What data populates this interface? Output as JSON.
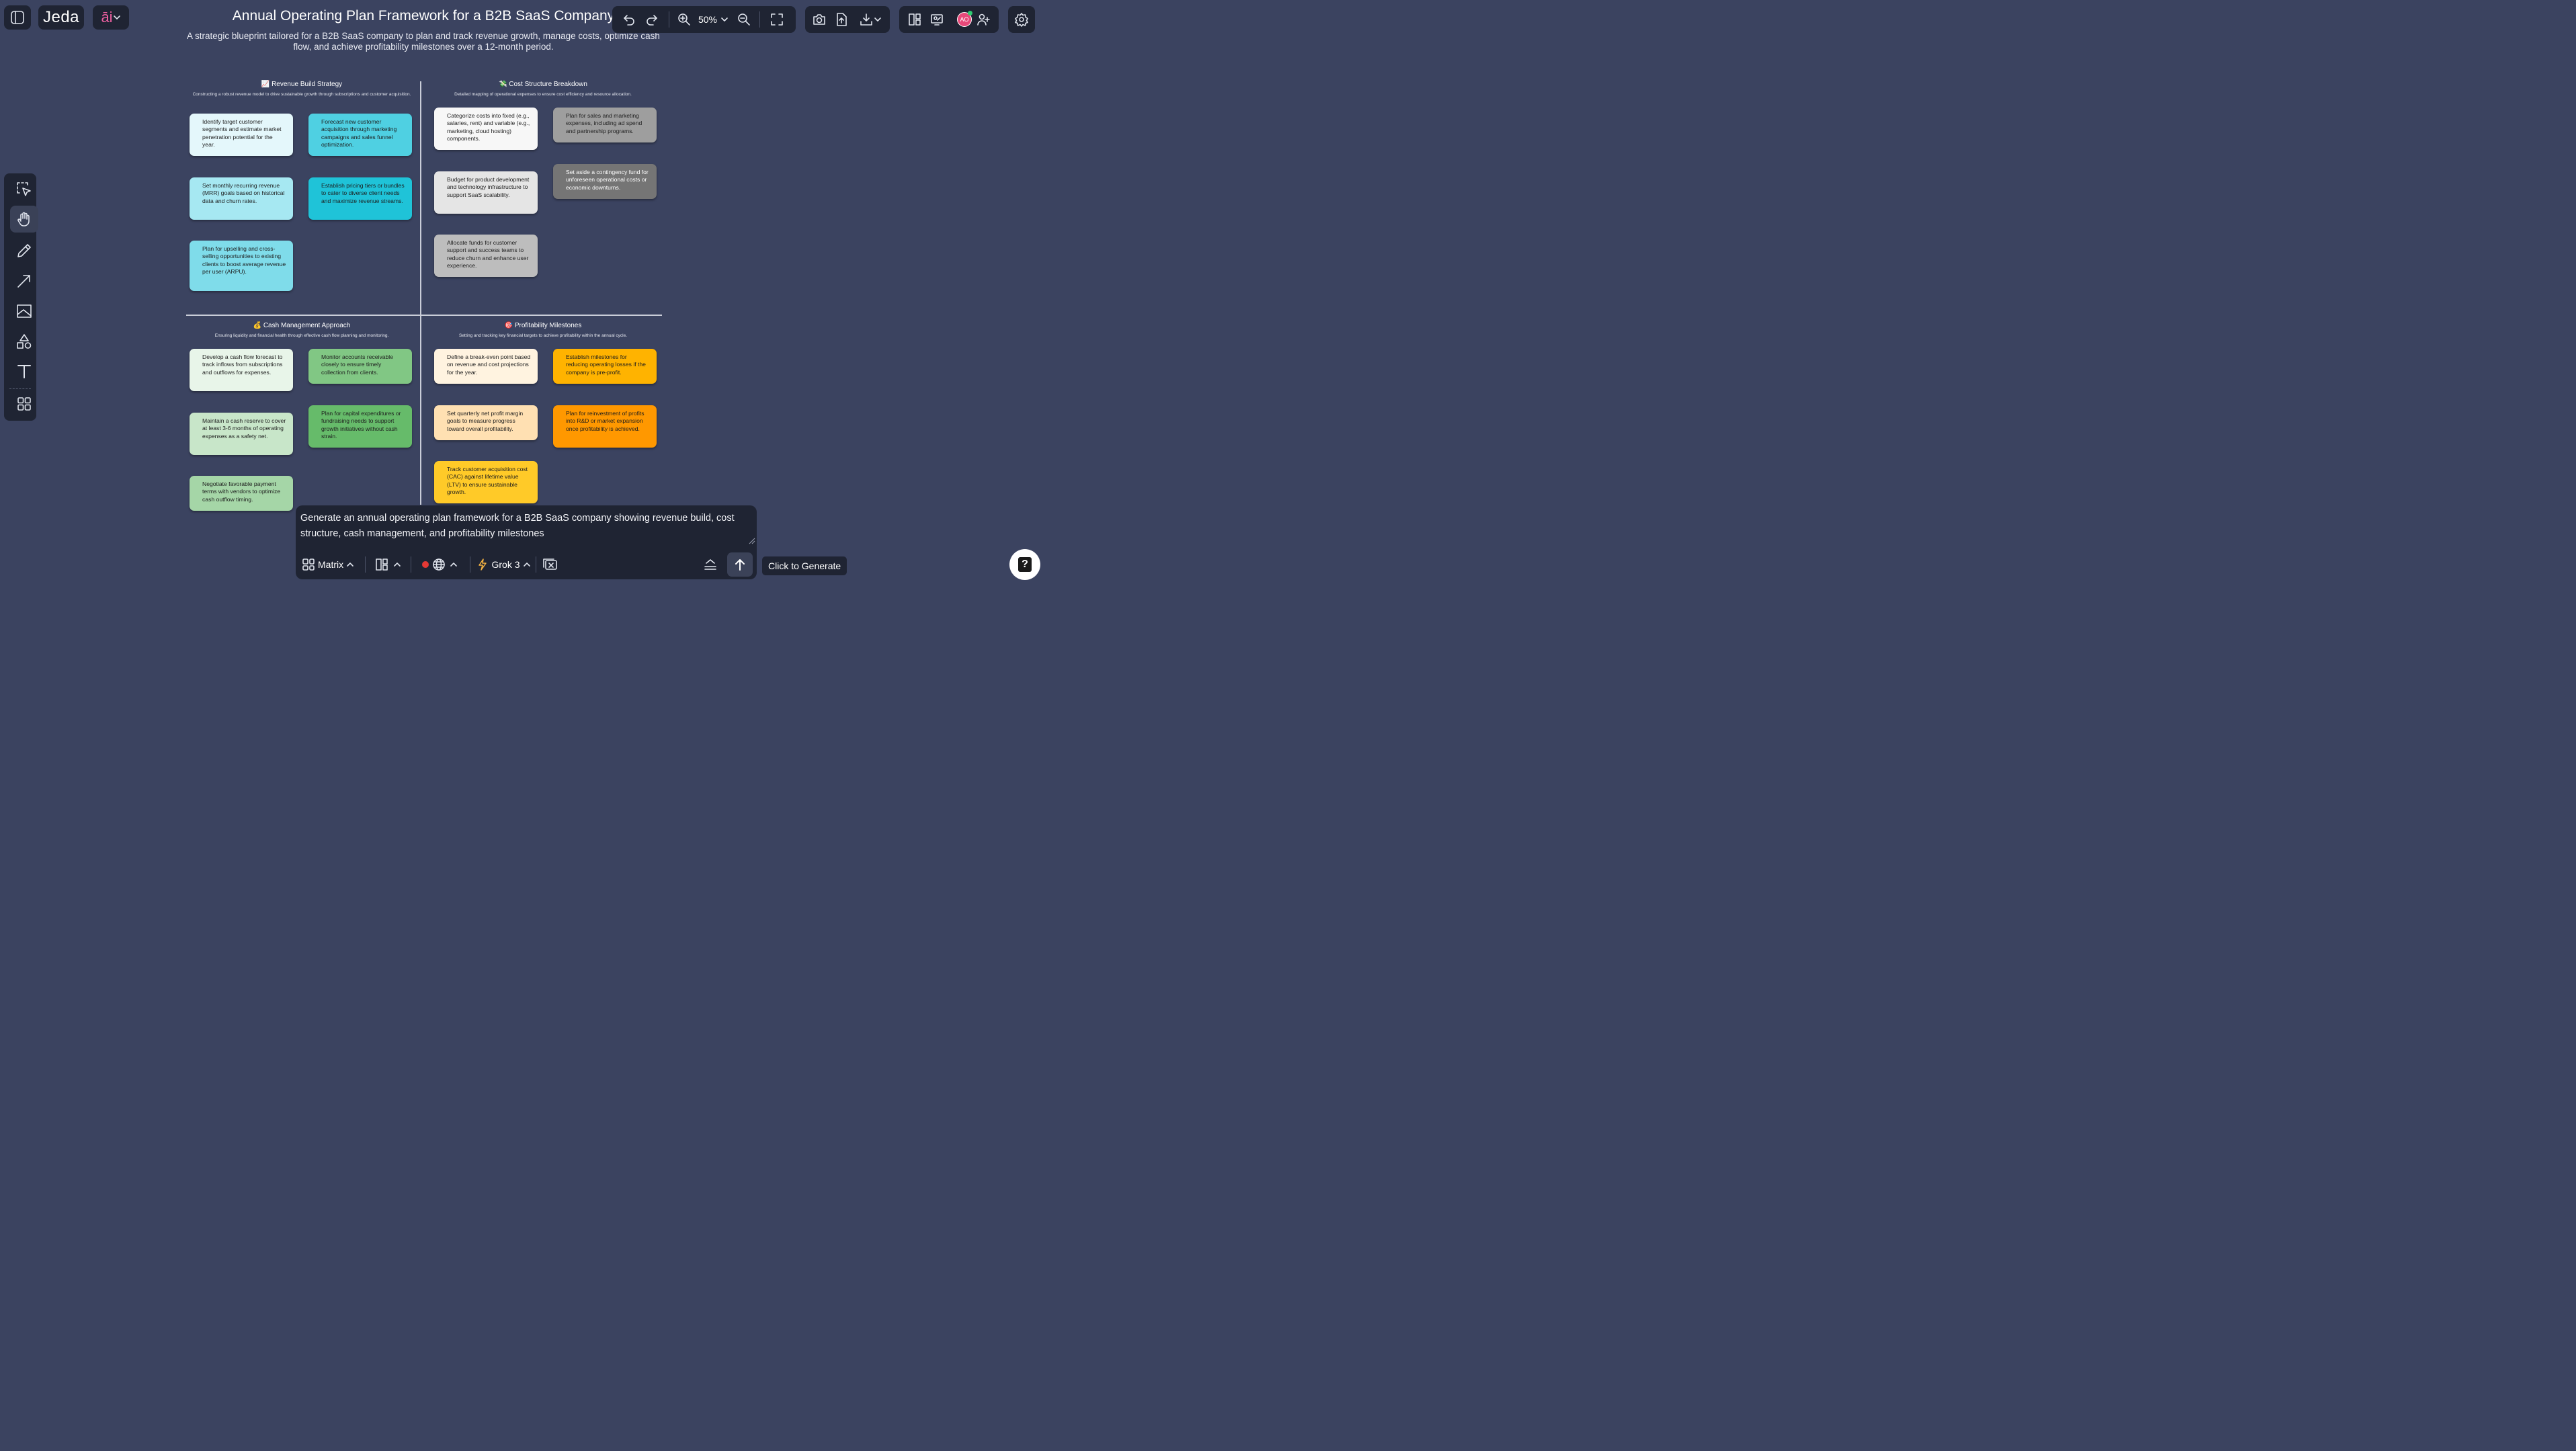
{
  "app": {
    "brand": "Jeda",
    "ai_label": "āi"
  },
  "toolbar": {
    "zoom": "50%"
  },
  "avatar": {
    "initials": "AO"
  },
  "header": {
    "title": "Annual Operating Plan Framework for a B2B SaaS Company",
    "subtitle": "A strategic blueprint tailored for a B2B SaaS company to plan and track revenue growth, manage costs, optimize cash flow, and achieve profitability milestones over a 12-month period."
  },
  "quadrants": [
    {
      "title": "📈 Revenue Build Strategy",
      "subtitle": "Constructing a robust revenue model to drive sustainable growth through subscriptions and customer acquisition.",
      "cards": [
        {
          "text": "Identify target customer segments and estimate market penetration potential for the year.",
          "color": "#e4f7fb"
        },
        {
          "text": "Forecast new customer acquisition through marketing campaigns and sales funnel optimization.",
          "color": "#4fd0e2"
        },
        {
          "text": "Set monthly recurring revenue (MRR) goals based on historical data and churn rates.",
          "color": "#a6e8f2"
        },
        {
          "text": "Establish pricing tiers or bundles to cater to diverse client needs and maximize revenue streams.",
          "color": "#1fc3d8"
        },
        {
          "text": "Plan for upselling and cross-selling opportunities to existing clients to boost average revenue per user (ARPU).",
          "color": "#7fdcea"
        }
      ]
    },
    {
      "title": "💸 Cost Structure Breakdown",
      "subtitle": "Detailed mapping of operational expenses to ensure cost efficiency and resource allocation.",
      "cards": [
        {
          "text": "Categorize costs into fixed (e.g., salaries, rent) and variable (e.g., marketing, cloud hosting) components.",
          "color": "#f7f7f7"
        },
        {
          "text": "Plan for sales and marketing expenses, including ad spend and partnership programs.",
          "color": "#9e9e9e"
        },
        {
          "text": "Budget for product development and technology infrastructure to support SaaS scalability.",
          "color": "#e5e5e5"
        },
        {
          "text": "Set aside a contingency fund for unforeseen operational costs or economic downturns.",
          "color": "#757575"
        },
        {
          "text": "Allocate funds for customer support and success teams to reduce churn and enhance user experience.",
          "color": "#bdbdbd"
        }
      ]
    },
    {
      "title": "💰 Cash Management Approach",
      "subtitle": "Ensuring liquidity and financial health through effective cash flow planning and monitoring.",
      "cards": [
        {
          "text": "Develop a cash flow forecast to track inflows from subscriptions and outflows for expenses.",
          "color": "#e8f5e9"
        },
        {
          "text": "Monitor accounts receivable closely to ensure timely collection from clients.",
          "color": "#81c784"
        },
        {
          "text": "Maintain a cash reserve to cover at least 3-6 months of operating expenses as a safety net.",
          "color": "#c8e6c9"
        },
        {
          "text": "Plan for capital expenditures or fundraising needs to support growth initiatives without cash strain.",
          "color": "#66bb6a"
        },
        {
          "text": "Negotiate favorable payment terms with vendors to optimize cash outflow timing.",
          "color": "#a5d6a7"
        }
      ]
    },
    {
      "title": "🎯 Profitability Milestones",
      "subtitle": "Setting and tracking key financial targets to achieve profitability within the annual cycle.",
      "cards": [
        {
          "text": "Define a break-even point based on revenue and cost projections for the year.",
          "color": "#fff3e0"
        },
        {
          "text": "Establish milestones for reducing operating losses if the company is pre-profit.",
          "color": "#ffb300"
        },
        {
          "text": "Set quarterly net profit margin goals to measure progress toward overall profitability.",
          "color": "#ffe0b2"
        },
        {
          "text": "Plan for reinvestment of profits into R&D or market expansion once profitability is achieved.",
          "color": "#ff9800"
        },
        {
          "text": "Track customer acquisition cost (CAC) against lifetime value (LTV) to ensure sustainable growth.",
          "color": "#ffca28"
        }
      ]
    }
  ],
  "prompt": {
    "text": "Generate an annual operating plan framework for a B2B SaaS company showing revenue build, cost structure, cash management, and profitability milestones",
    "layout_label": "Matrix",
    "model_label": "Grok 3",
    "generate_tooltip": "Click to Generate"
  },
  "help": {
    "label": "?"
  }
}
